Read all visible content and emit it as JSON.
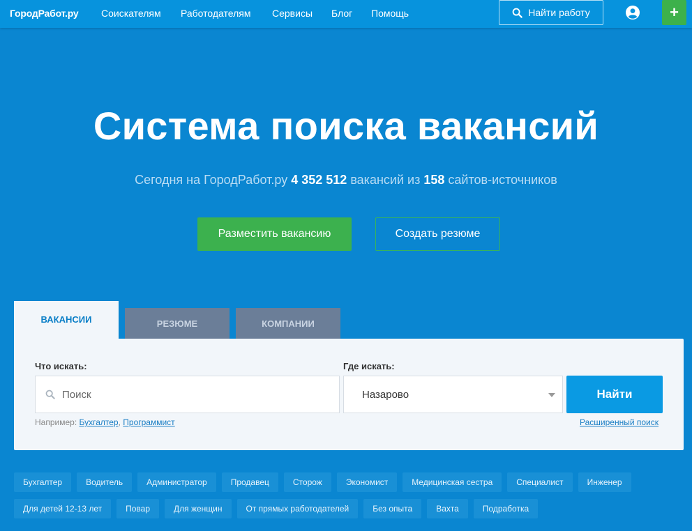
{
  "nav": {
    "logo": "ГородРабот.ру",
    "links": [
      "Соискателям",
      "Работодателям",
      "Сервисы",
      "Блог",
      "Помощь"
    ],
    "search_label": "Найти работу",
    "plus_label": "+"
  },
  "hero": {
    "title": "Система поиска вакансий",
    "sub_prefix": "Сегодня на ГородРабот.ру",
    "vacancy_count": "4 352 512",
    "sub_middle": "вакансий из",
    "source_count": "158",
    "sub_suffix": "сайтов-источников",
    "post_button": "Разместить вакансию",
    "resume_button": "Создать резюме"
  },
  "tabs": [
    {
      "label": "ВАКАНСИИ",
      "active": true
    },
    {
      "label": "РЕЗЮМЕ",
      "active": false
    },
    {
      "label": "КОМПАНИИ",
      "active": false
    }
  ],
  "search": {
    "what_label": "Что искать:",
    "what_placeholder": "Поиск",
    "where_label": "Где искать:",
    "where_value": "Назарово",
    "find_button": "Найти",
    "example_prefix": "Например:",
    "example_1": "Бухгалтер",
    "example_2": "Программист",
    "advanced_link": "Расширенный поиск"
  },
  "chips": {
    "row1": [
      "Бухгалтер",
      "Водитель",
      "Администратор",
      "Продавец",
      "Сторож",
      "Экономист",
      "Медицинская сестра",
      "Специалист",
      "Инженер"
    ],
    "row2": [
      "Для детей 12-13 лет",
      "Повар",
      "Для женщин",
      "От прямых работодателей",
      "Без опыта",
      "Вахта",
      "Подработка"
    ]
  },
  "colors": {
    "background": "#0a86d1",
    "nav": "#0793dd",
    "green": "#3cb14e",
    "find": "#0a9ae3"
  }
}
